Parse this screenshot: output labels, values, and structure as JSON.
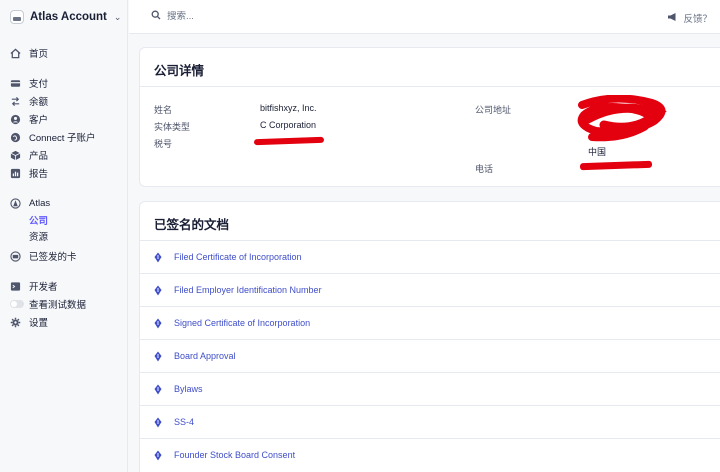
{
  "account": {
    "name": "Atlas Account"
  },
  "sidebar": {
    "home": "首页",
    "payments": "支付",
    "balance": "余额",
    "customers": "客户",
    "connect": "Connect 子账户",
    "products": "产品",
    "reports": "报告",
    "atlas": "Atlas",
    "atlas_company": "公司",
    "atlas_resources": "资源",
    "issued_cards": "已签发的卡",
    "developers": "开发者",
    "view_test_data": "查看测试数据",
    "settings": "设置"
  },
  "topbar": {
    "search_placeholder": "搜索...",
    "feedback": "反馈？"
  },
  "company": {
    "title": "公司详情",
    "name_label": "姓名",
    "name_value": "bitfishxyz, Inc.",
    "entity_label": "实体类型",
    "entity_value": "C Corporation",
    "tax_label": "税号",
    "address_label": "公司地址",
    "country": "中国",
    "phone_label": "电话"
  },
  "documents": {
    "title": "已签名的文档",
    "items": [
      "Filed Certificate of Incorporation",
      "Filed Employer Identification Number",
      "Signed Certificate of Incorporation",
      "Board Approval",
      "Bylaws",
      "SS-4",
      "Founder Stock Board Consent"
    ]
  },
  "colors": {
    "accent": "#635bff",
    "link": "#3f4ec9",
    "redaction": "#e3000f"
  }
}
